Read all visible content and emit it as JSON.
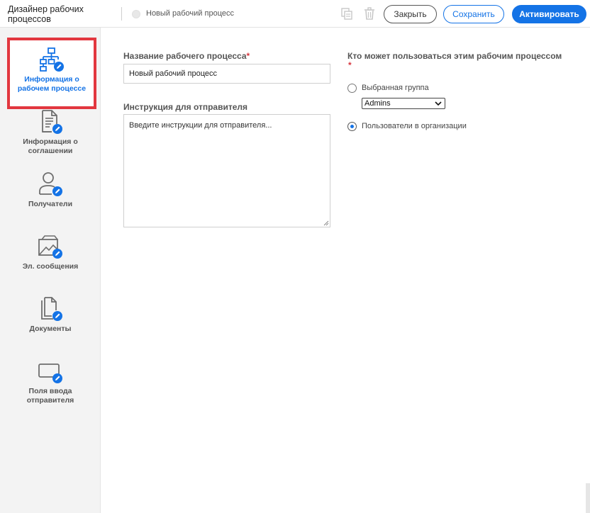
{
  "header": {
    "app_title": "Дизайнер рабочих процессов",
    "workflow_name": "Новый рабочий процесс",
    "close_label": "Закрыть",
    "save_label": "Сохранить",
    "activate_label": "Активировать"
  },
  "sidebar": {
    "items": [
      {
        "label": "Информация о рабочем процессе",
        "icon": "workflow-hierarchy-icon",
        "active": true
      },
      {
        "label": "Информация о соглашении",
        "icon": "document-edit-icon",
        "active": false
      },
      {
        "label": "Получатели",
        "icon": "user-edit-icon",
        "active": false
      },
      {
        "label": "Эл. сообщения",
        "icon": "email-edit-icon",
        "active": false
      },
      {
        "label": "Документы",
        "icon": "documents-edit-icon",
        "active": false
      },
      {
        "label": "Поля ввода отправителя",
        "icon": "input-field-edit-icon",
        "active": false
      }
    ]
  },
  "form": {
    "name_label": "Название рабочего процесса",
    "name_value": "Новый рабочий процесс",
    "instructions_label": "Инструкция для отправителя",
    "instructions_placeholder": "Введите инструкции для отправителя...",
    "access_label": "Кто может пользоваться этим рабочим процессом",
    "required_mark": "*",
    "option_group_label": "Выбранная группа",
    "group_select_value": "Admins",
    "option_org_label": "Пользователи в организации",
    "selected_option": "org"
  },
  "colors": {
    "accent": "#1473e6",
    "highlight": "#e2373f",
    "required": "#d7373f"
  }
}
